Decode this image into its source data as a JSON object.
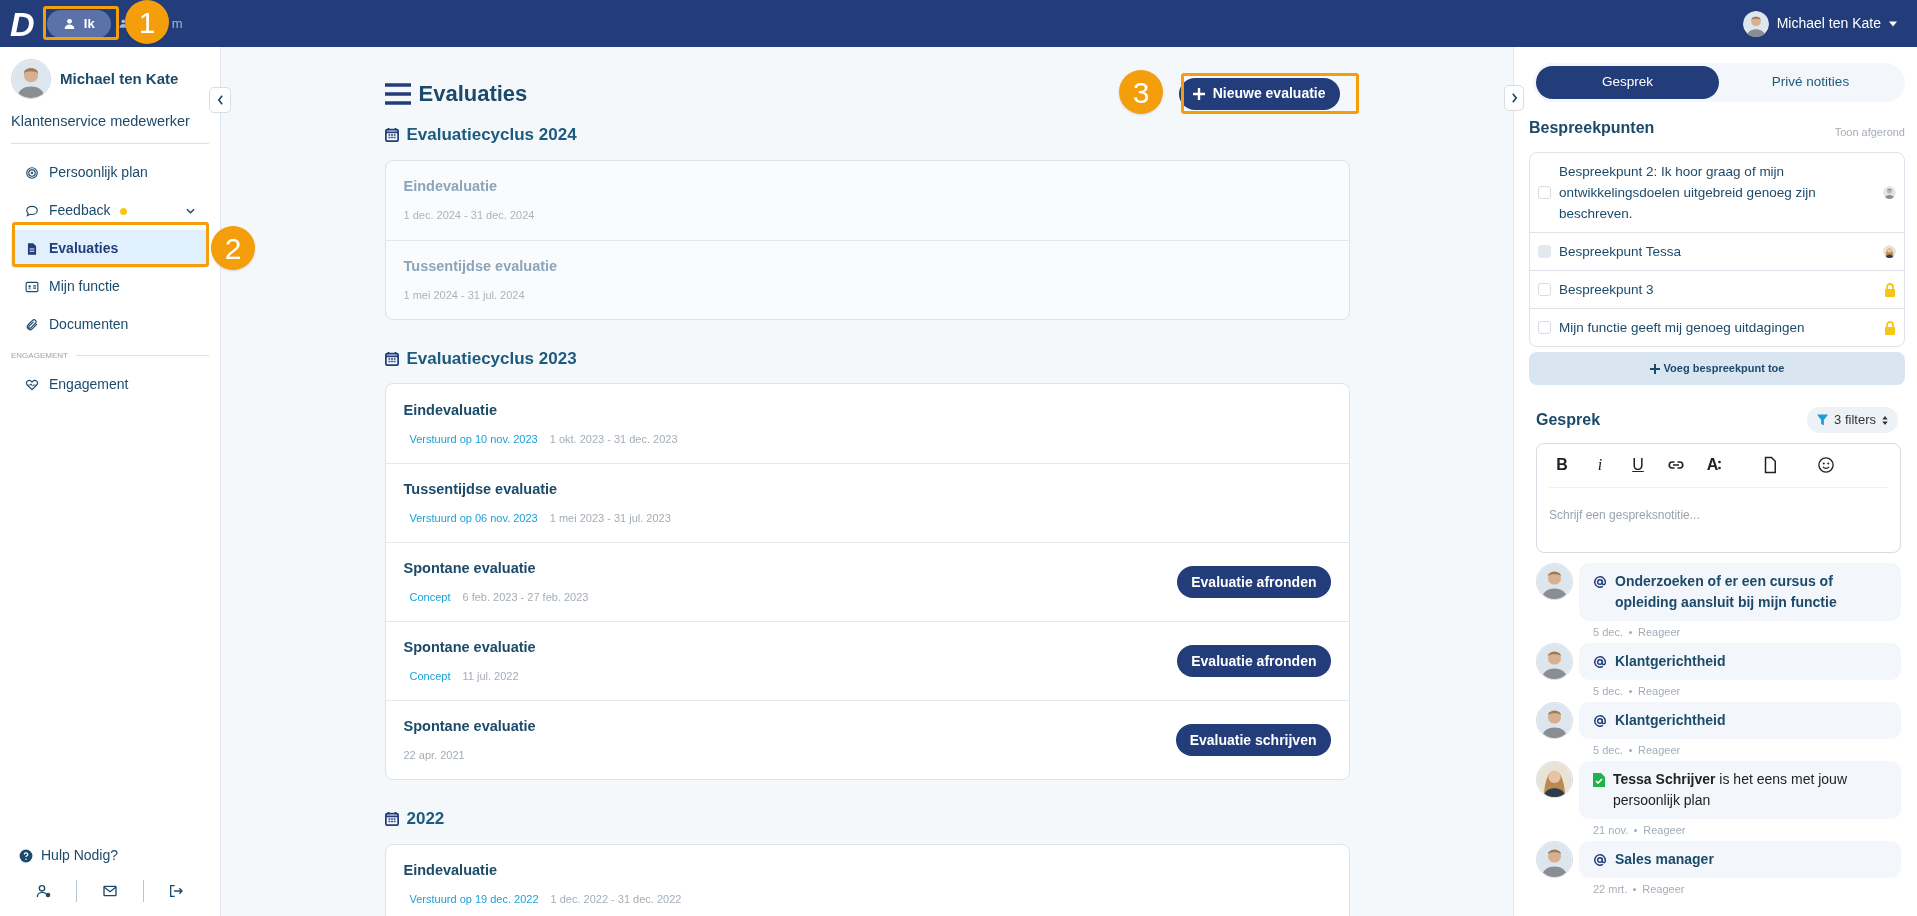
{
  "header": {
    "logo": "D",
    "tabs": [
      {
        "label": "Ik",
        "selected": true
      },
      {
        "label": "m",
        "selected": false
      }
    ],
    "user": {
      "name": "Michael ten Kate"
    }
  },
  "annotations": [
    {
      "number": "1"
    },
    {
      "number": "2"
    },
    {
      "number": "3"
    }
  ],
  "sidebar": {
    "profile": {
      "name": "Michael ten Kate",
      "role": "Klantenservice medewerker"
    },
    "items": [
      {
        "label": "Persoonlijk plan",
        "selected": false,
        "notification": false,
        "expandable": false
      },
      {
        "label": "Feedback",
        "selected": false,
        "notification": true,
        "expandable": true
      },
      {
        "label": "Evaluaties",
        "selected": true,
        "notification": false,
        "expandable": false
      },
      {
        "label": "Mijn functie",
        "selected": false,
        "notification": false,
        "expandable": false
      },
      {
        "label": "Documenten",
        "selected": false,
        "notification": false,
        "expandable": false
      }
    ],
    "section": {
      "label": "ENGAGEMENT",
      "items": [
        {
          "label": "Engagement",
          "selected": false,
          "notification": false,
          "expandable": false
        }
      ]
    },
    "help": "Hulp Nodig?"
  },
  "main": {
    "title": "Evaluaties",
    "new_button": "Nieuwe evaluatie",
    "cycles": [
      {
        "title": "Evaluatiecyclus 2024",
        "items": [
          {
            "title": "Eindevaluatie",
            "dates": "1 dec. 2024 - 31 dec. 2024",
            "muted": true
          },
          {
            "title": "Tussentijdse evaluatie",
            "dates": "1 mei 2024 - 31 jul. 2024",
            "muted": true
          }
        ]
      },
      {
        "title": "Evaluatiecyclus 2023",
        "items": [
          {
            "title": "Eindevaluatie",
            "status": "Verstuurd op 10 nov. 2023",
            "dates": "1 okt. 2023 - 31 dec. 2023",
            "muted": false
          },
          {
            "title": "Tussentijdse evaluatie",
            "status": "Verstuurd op 06 nov. 2023",
            "dates": "1 mei 2023 - 31 jul. 2023",
            "muted": false
          },
          {
            "title": "Spontane evaluatie",
            "status": "Concept",
            "dates": "6 feb. 2023 - 27 feb. 2023",
            "action": "Evaluatie afronden",
            "muted": false
          },
          {
            "title": "Spontane evaluatie",
            "status": "Concept",
            "dates": "11 jul. 2022",
            "action": "Evaluatie afronden",
            "muted": false
          },
          {
            "title": "Spontane evaluatie",
            "dates": "22 apr. 2021",
            "action": "Evaluatie schrijven",
            "muted": false
          }
        ]
      },
      {
        "title": "2022",
        "items": [
          {
            "title": "Eindevaluatie",
            "status": "Verstuurd op 19 dec. 2022",
            "dates": "1 dec. 2022 - 31 dec. 2022",
            "muted": false
          }
        ]
      }
    ]
  },
  "panel": {
    "tabs": [
      {
        "label": "Gesprek",
        "selected": true
      },
      {
        "label": "Privé notities",
        "selected": false
      }
    ],
    "points_title": "Bespreekpunten",
    "show_done": "Toon afgerond",
    "points": [
      {
        "text": "Bespreekpunt 2: Ik hoor graag of mijn ontwikkelingsdoelen uitgebreid genoeg zijn beschreven.",
        "checked": false,
        "disabled": false,
        "kind": "avatar"
      },
      {
        "text": "Bespreekpunt Tessa",
        "checked": false,
        "disabled": true,
        "kind": "avatar"
      },
      {
        "text": "Bespreekpunt 3",
        "checked": false,
        "disabled": false,
        "kind": "locked"
      },
      {
        "text": "Mijn functie geeft mij genoeg uitdagingen",
        "checked": false,
        "disabled": false,
        "kind": "locked"
      }
    ],
    "add_point": "Voeg bespreekpunt toe",
    "conversation": {
      "title": "Gesprek",
      "filter": "3 filters",
      "toolbar": [
        {
          "kind": "bold",
          "label": "B"
        },
        {
          "kind": "italic",
          "label": "i"
        },
        {
          "kind": "underline",
          "label": "U"
        },
        {
          "kind": "link"
        },
        {
          "kind": "text-size",
          "label": "A"
        },
        {
          "kind": "file"
        },
        {
          "kind": "emoji"
        }
      ],
      "placeholder": "Schrijf een gespreksnotitie...",
      "comments": [
        {
          "kind": "mention",
          "text": "Onderzoeken of er een cursus of opleiding aansluit bij mijn functie",
          "date": "5 dec.",
          "reply": "Reageer"
        },
        {
          "kind": "mention",
          "text": "Klantgerichtheid",
          "date": "5 dec.",
          "reply": "Reageer"
        },
        {
          "kind": "mention",
          "text": "Klantgerichtheid",
          "date": "5 dec.",
          "reply": "Reageer"
        },
        {
          "kind": "agreement",
          "text": "**Tessa Schrijver** is het eens met jouw persoonlijk plan",
          "date": "21 nov.",
          "reply": "Reageer"
        },
        {
          "kind": "mention",
          "text": "Sales manager",
          "date": "22 mrt.",
          "reply": "Reageer"
        }
      ]
    }
  }
}
